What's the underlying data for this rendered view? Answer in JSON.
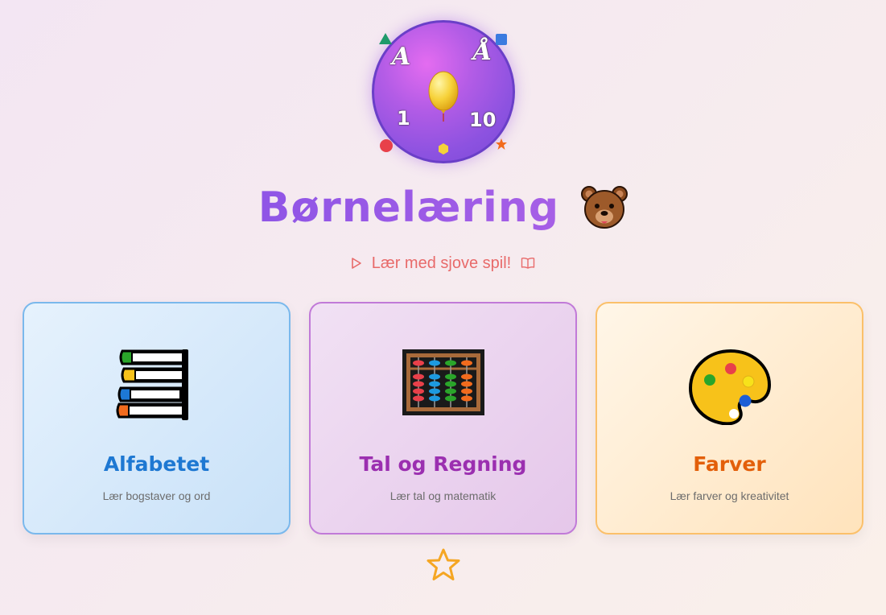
{
  "logo": {
    "letter_a": "A",
    "letter_aa": "Å",
    "num_one": "1",
    "num_ten": "10"
  },
  "header": {
    "title": "Børnelæring",
    "subtitle": "Lær med sjove spil!"
  },
  "cards": [
    {
      "title": "Alfabetet",
      "description": "Lær bogstaver og ord",
      "icon": "books-icon",
      "accent": "#1e78d2"
    },
    {
      "title": "Tal og Regning",
      "description": "Lær tal og matematik",
      "icon": "abacus-icon",
      "accent": "#9b2fb0"
    },
    {
      "title": "Farver",
      "description": "Lær farver og kreativitet",
      "icon": "palette-icon",
      "accent": "#e35f0a"
    }
  ],
  "colors": {
    "title": "#9c5ce8",
    "subtitle": "#e86a6a",
    "star": "#f5a623"
  }
}
